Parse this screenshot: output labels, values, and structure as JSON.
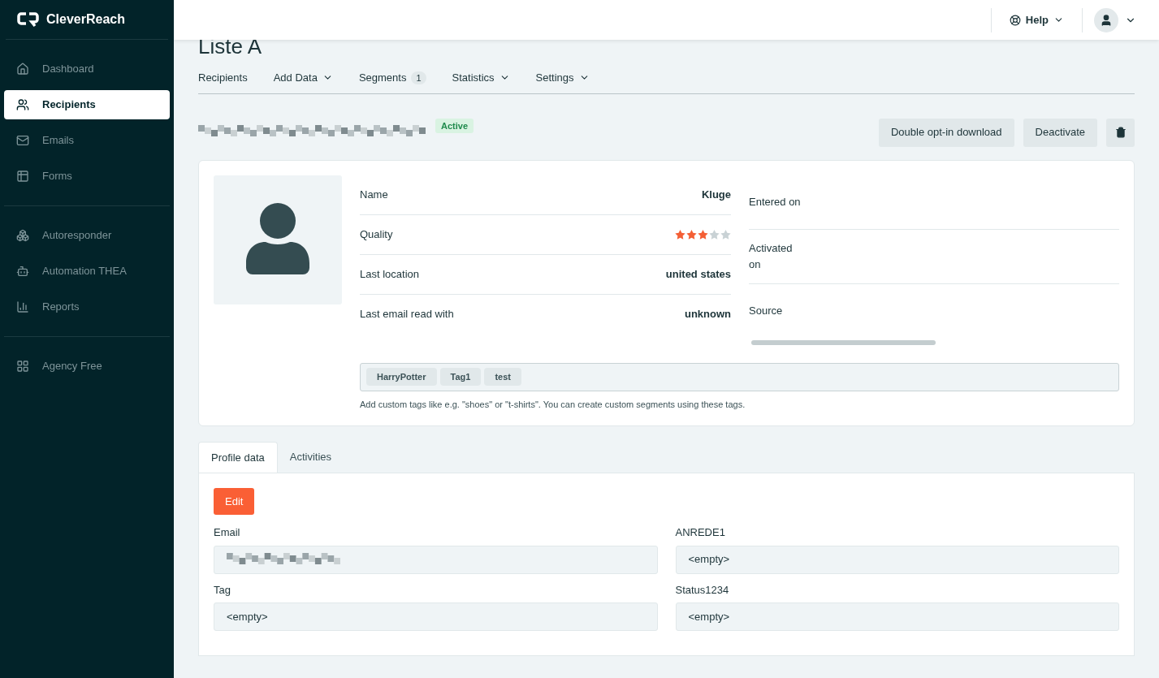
{
  "brand": {
    "name": "CleverReach"
  },
  "sidebar": {
    "sections": [
      {
        "items": [
          {
            "label": "Dashboard",
            "selected": false
          },
          {
            "label": "Recipients",
            "selected": true
          },
          {
            "label": "Emails",
            "selected": false
          },
          {
            "label": "Forms",
            "selected": false
          }
        ]
      },
      {
        "items": [
          {
            "label": "Autoresponder",
            "selected": false
          },
          {
            "label": "Automation THEA",
            "selected": false
          },
          {
            "label": "Reports",
            "selected": false
          }
        ]
      },
      {
        "items": [
          {
            "label": "Agency Free",
            "selected": false
          }
        ]
      }
    ]
  },
  "header": {
    "help": "Help"
  },
  "page": {
    "title": "Liste A",
    "nav": [
      {
        "label": "Recipients",
        "dropdown": false,
        "selected": false
      },
      {
        "label": "Add Data",
        "dropdown": true,
        "selected": false
      },
      {
        "label": "Segments",
        "badge": "1",
        "dropdown": false,
        "selected": false
      },
      {
        "label": "Statistics",
        "dropdown": true,
        "selected": false
      },
      {
        "label": "Settings",
        "dropdown": true,
        "selected": false
      }
    ],
    "recipient": {
      "status": "Active",
      "actions": [
        "Double opt-in download",
        "Deactivate"
      ]
    },
    "details": [
      {
        "label": "Name",
        "kind": "text",
        "value": "Kluge"
      },
      {
        "label": "Quality",
        "kind": "stars",
        "stars": 3
      },
      {
        "label": "Last location",
        "kind": "text",
        "value": "united states"
      },
      {
        "label": "Last email read with",
        "kind": "text",
        "value": "unknown"
      }
    ],
    "dates": [
      {
        "label": "Entered on"
      },
      {
        "label": "Activated on"
      },
      {
        "label": "Source"
      }
    ],
    "tags": [
      "HarryPotter",
      "Tag1",
      "test"
    ],
    "tags_hint": "Add custom tags like e.g. \"shoes\" or \"t-shirts\". You can create custom segments using these tags.",
    "tabs": [
      {
        "label": "Profile data",
        "selected": true
      },
      {
        "label": "Activities",
        "selected": false
      }
    ],
    "edit_button": "Edit",
    "fields": [
      {
        "label": "Email",
        "kind": "redacted"
      },
      {
        "label": "ANREDE1",
        "kind": "text",
        "value": "<empty>"
      },
      {
        "label": "Tag",
        "kind": "text",
        "value": "<empty>"
      },
      {
        "label": "Status1234",
        "kind": "text",
        "value": "<empty>"
      }
    ]
  }
}
